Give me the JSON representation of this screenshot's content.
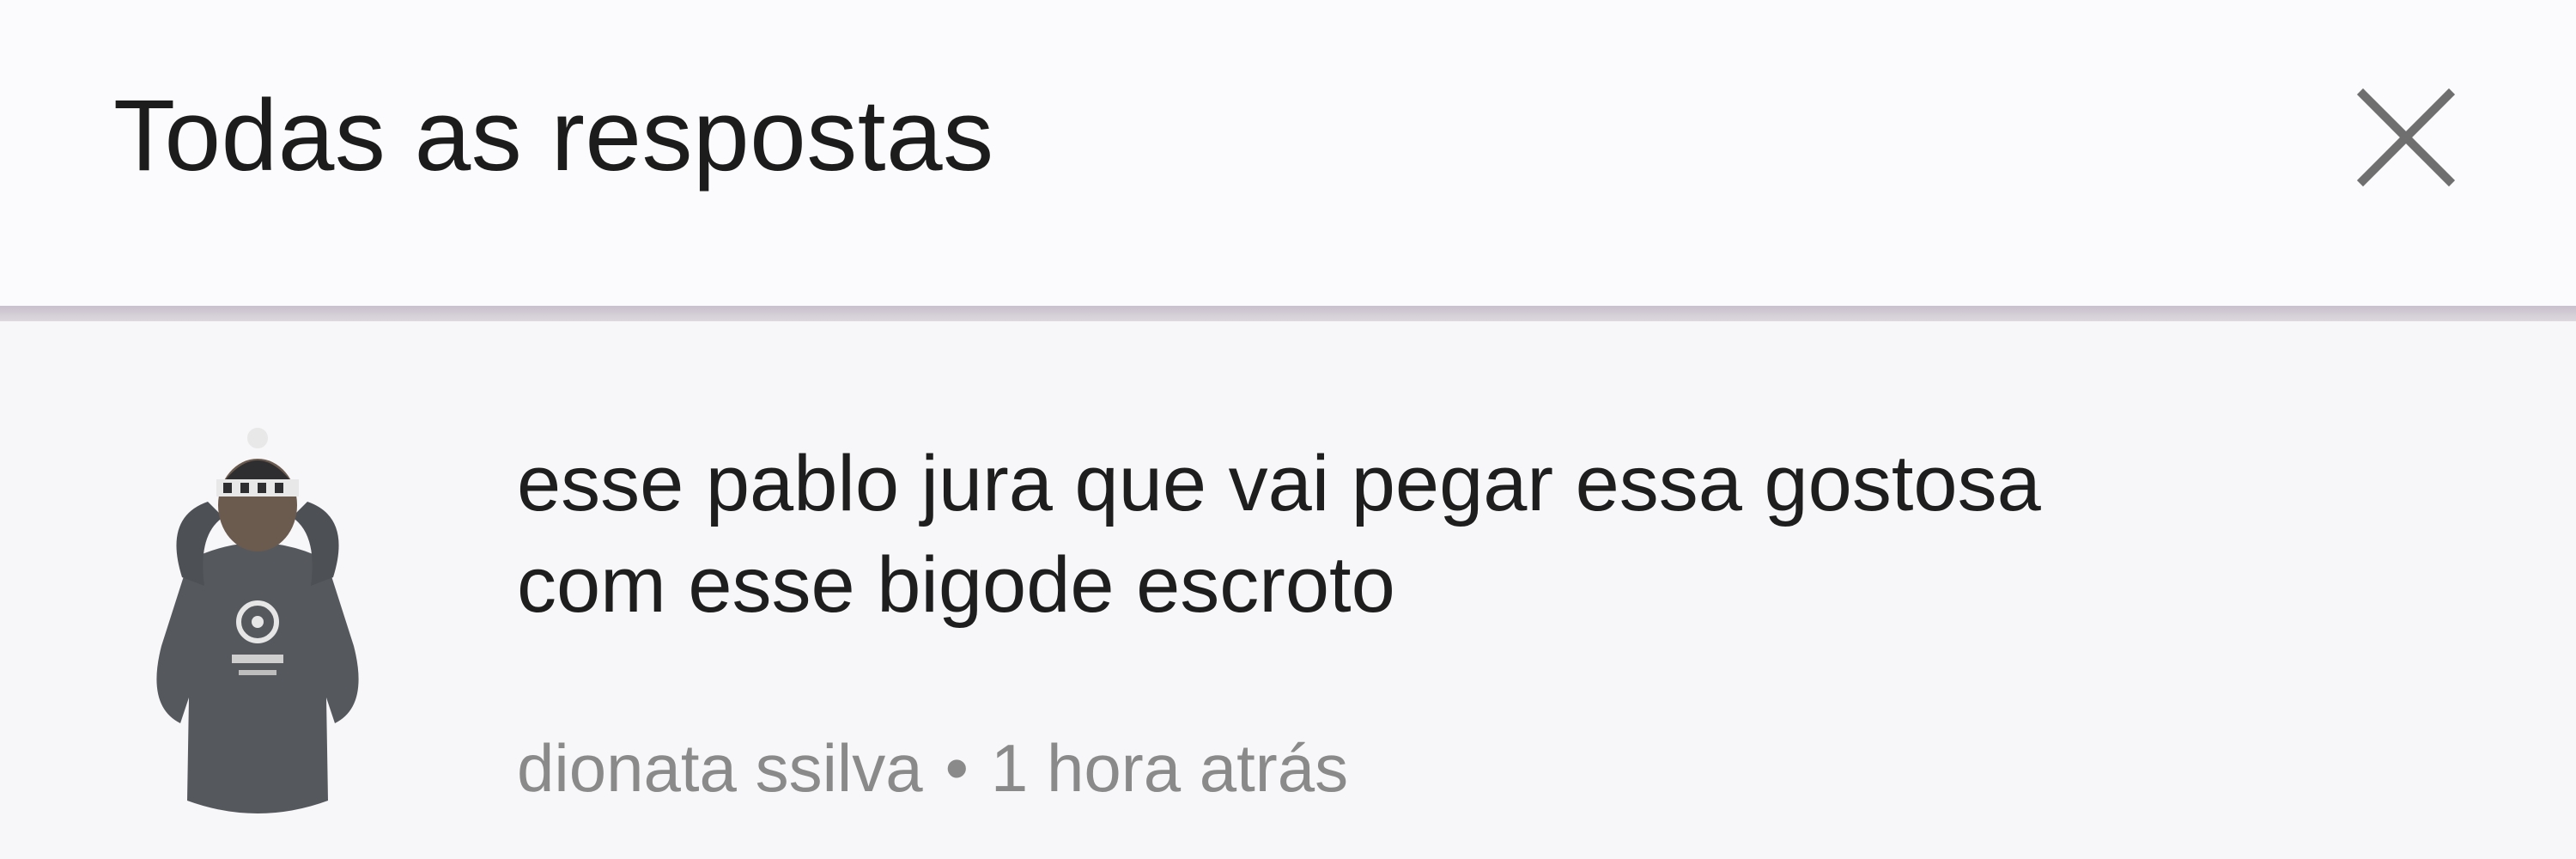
{
  "header": {
    "title": "Todas as respostas",
    "close_icon": "close-icon"
  },
  "comment": {
    "avatar_icon": "user-avatar",
    "text_lines": [
      "esse pablo jura que vai pegar essa gostosa",
      "com esse bigode escroto"
    ],
    "author": "dionata ssilva",
    "separator": "•",
    "time": "1 hora atrás"
  },
  "colors": {
    "background": "#f7f6f8",
    "header_background": "#fbfafc",
    "text": "#1e1e1e",
    "meta_text": "#8a8a8a",
    "divider": "#c8c0cc"
  }
}
